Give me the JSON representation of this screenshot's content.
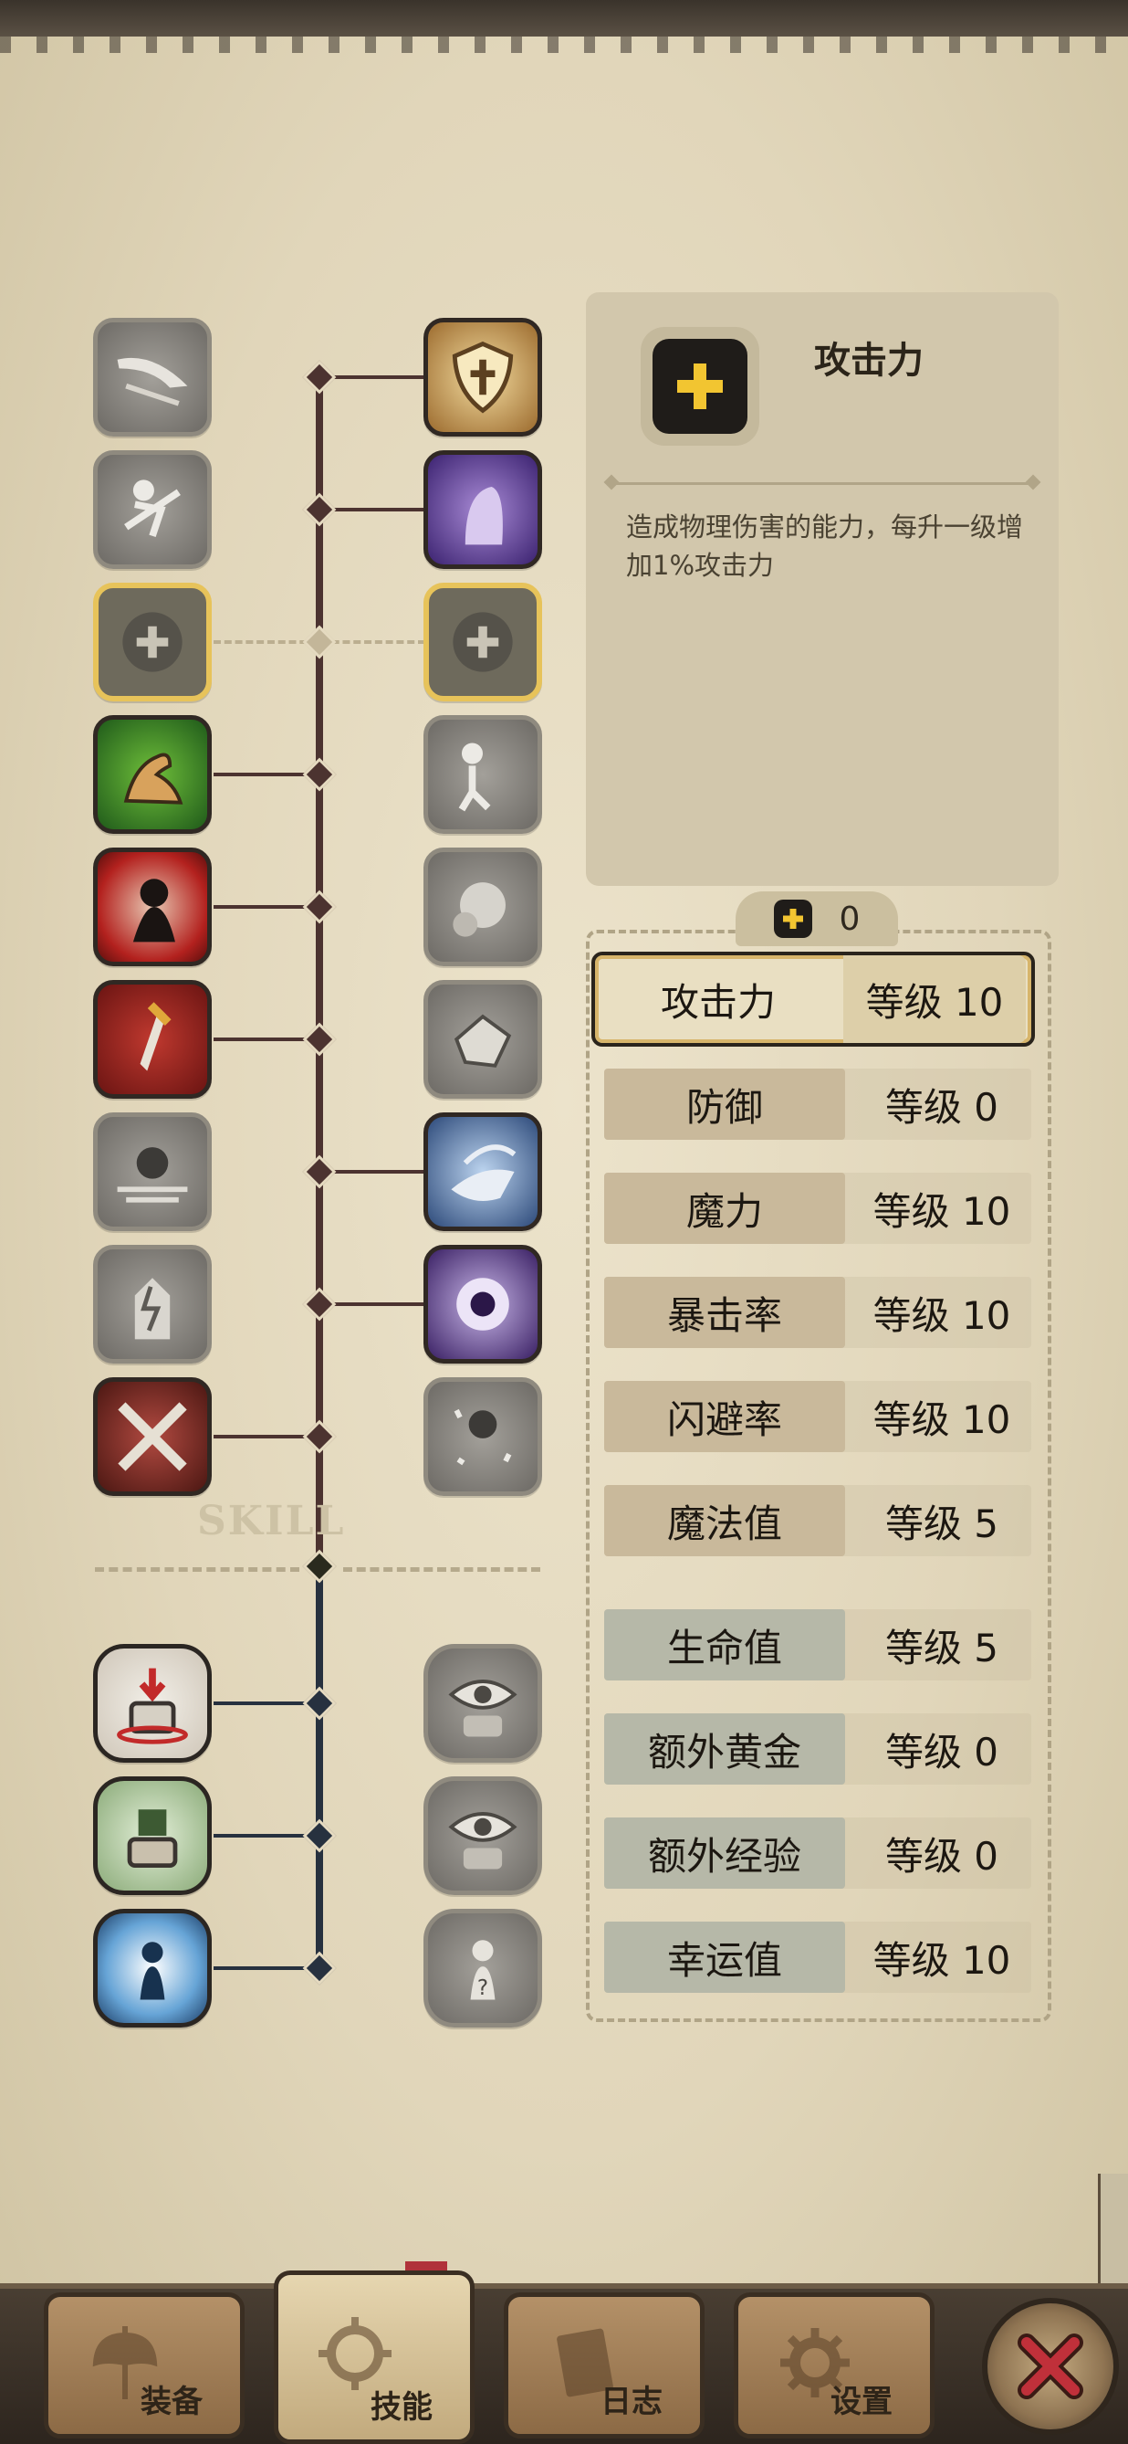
{
  "selected_skill": {
    "icon": "plus-icon",
    "title": "攻击力",
    "description": "造成物理伤害的能力，每升一级增加1%攻击力"
  },
  "skill_points": {
    "icon": "plus-icon",
    "value": "0"
  },
  "tree": {
    "label": "SKILL"
  },
  "attributes": [
    {
      "name": "攻击力",
      "level": "等级 10",
      "selected": true
    },
    {
      "name": "防御",
      "level": "等级 0"
    },
    {
      "name": "魔力",
      "level": "等级 10"
    },
    {
      "name": "暴击率",
      "level": "等级 10"
    },
    {
      "name": "闪避率",
      "level": "等级 10"
    },
    {
      "name": "魔法值",
      "level": "等级 5"
    },
    {
      "name": "生命值",
      "level": "等级 5"
    },
    {
      "name": "额外黄金",
      "level": "等级 0"
    },
    {
      "name": "额外经验",
      "level": "等级 0"
    },
    {
      "name": "幸运值",
      "level": "等级 10"
    }
  ],
  "nav": {
    "equip": "装备",
    "skills": "技能",
    "log": "日志",
    "settings": "设置",
    "close_icon": "close-icon"
  },
  "colors": {
    "active_border": "#e7c35a",
    "tree_line": "#4c3330",
    "tree_line_bottom": "#27313f",
    "close_x": "#c0303a"
  }
}
